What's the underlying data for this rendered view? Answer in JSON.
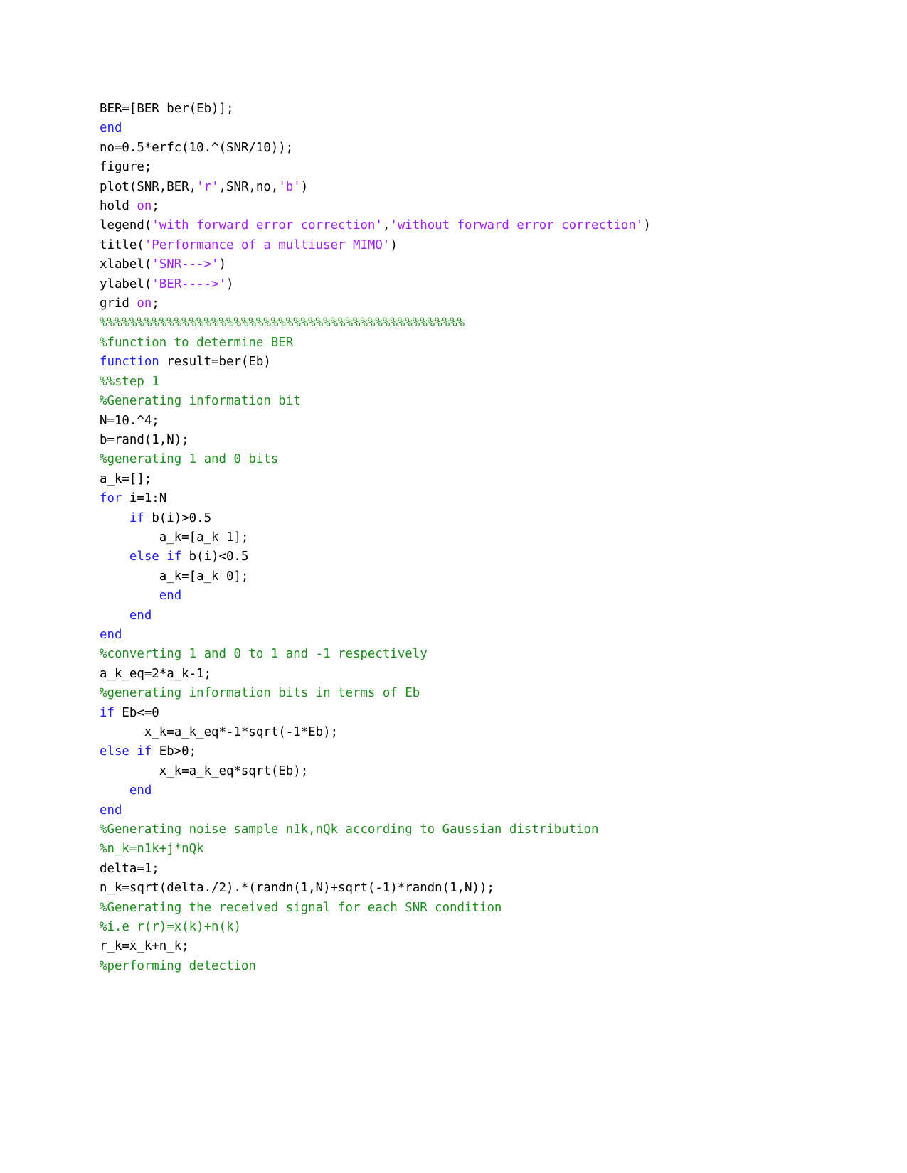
{
  "document": {
    "type": "matlab-source-listing",
    "page_background": "#ffffff",
    "colors": {
      "keyword": "#2222e8",
      "string": "#a020f0",
      "comment": "#228b22",
      "plain": "#000000"
    },
    "lines": [
      {
        "id": "line-1",
        "tokens": [
          {
            "t": "BER=[BER ber(Eb)];",
            "c": "plain"
          }
        ]
      },
      {
        "id": "line-2",
        "tokens": [
          {
            "t": "end",
            "c": "key"
          }
        ]
      },
      {
        "id": "line-3",
        "tokens": [
          {
            "t": "no=0.5*erfc(10.^(SNR/10));",
            "c": "plain"
          }
        ]
      },
      {
        "id": "line-4",
        "tokens": [
          {
            "t": "figure;",
            "c": "plain"
          }
        ]
      },
      {
        "id": "line-5",
        "tokens": [
          {
            "t": "plot(SNR,BER,",
            "c": "plain"
          },
          {
            "t": "'r'",
            "c": "str"
          },
          {
            "t": ",SNR,no,",
            "c": "plain"
          },
          {
            "t": "'b'",
            "c": "str"
          },
          {
            "t": ")",
            "c": "plain"
          }
        ]
      },
      {
        "id": "line-6",
        "tokens": [
          {
            "t": "hold ",
            "c": "plain"
          },
          {
            "t": "on",
            "c": "str"
          },
          {
            "t": ";",
            "c": "plain"
          }
        ]
      },
      {
        "id": "line-7",
        "tokens": [
          {
            "t": "legend(",
            "c": "plain"
          },
          {
            "t": "'with forward error correction'",
            "c": "str"
          },
          {
            "t": ",",
            "c": "plain"
          },
          {
            "t": "'without forward error correction'",
            "c": "str"
          },
          {
            "t": ")",
            "c": "plain"
          }
        ]
      },
      {
        "id": "line-8",
        "tokens": [
          {
            "t": "title(",
            "c": "plain"
          },
          {
            "t": "'Performance of a multiuser MIMO'",
            "c": "str"
          },
          {
            "t": ")",
            "c": "plain"
          }
        ]
      },
      {
        "id": "line-9",
        "tokens": [
          {
            "t": "xlabel(",
            "c": "plain"
          },
          {
            "t": "'SNR--->'",
            "c": "str"
          },
          {
            "t": ")",
            "c": "plain"
          }
        ]
      },
      {
        "id": "line-10",
        "tokens": [
          {
            "t": "ylabel(",
            "c": "plain"
          },
          {
            "t": "'BER---->'",
            "c": "str"
          },
          {
            "t": ")",
            "c": "plain"
          }
        ]
      },
      {
        "id": "line-11",
        "tokens": [
          {
            "t": "grid ",
            "c": "plain"
          },
          {
            "t": "on",
            "c": "str"
          },
          {
            "t": ";",
            "c": "plain"
          }
        ]
      },
      {
        "id": "line-12",
        "tokens": [
          {
            "t": "%%%%%%%%%%%%%%%%%%%%%%%%%%%%%%%%%%%%%%%%%%%%%%%%%",
            "c": "com"
          }
        ]
      },
      {
        "id": "line-13",
        "tokens": [
          {
            "t": "%function to determine BER",
            "c": "com"
          }
        ]
      },
      {
        "id": "line-14",
        "tokens": [
          {
            "t": "function",
            "c": "key"
          },
          {
            "t": " result=ber(Eb)",
            "c": "plain"
          }
        ]
      },
      {
        "id": "line-15",
        "tokens": [
          {
            "t": "%%step 1",
            "c": "com"
          }
        ]
      },
      {
        "id": "line-16",
        "tokens": [
          {
            "t": "%Generating information bit",
            "c": "com"
          }
        ]
      },
      {
        "id": "line-17",
        "tokens": [
          {
            "t": "N=10.^4;",
            "c": "plain"
          }
        ]
      },
      {
        "id": "line-18",
        "tokens": [
          {
            "t": "b=rand(1,N);",
            "c": "plain"
          }
        ]
      },
      {
        "id": "line-19",
        "tokens": [
          {
            "t": "%generating 1 and 0 bits",
            "c": "com"
          }
        ]
      },
      {
        "id": "line-20",
        "tokens": [
          {
            "t": "a_k=[];",
            "c": "plain"
          }
        ]
      },
      {
        "id": "line-21",
        "tokens": [
          {
            "t": "for",
            "c": "key"
          },
          {
            "t": " i=1:N",
            "c": "plain"
          }
        ]
      },
      {
        "id": "line-22",
        "tokens": [
          {
            "t": "    ",
            "c": "plain"
          },
          {
            "t": "if",
            "c": "key"
          },
          {
            "t": " b(i)>0.5",
            "c": "plain"
          }
        ]
      },
      {
        "id": "line-23",
        "tokens": [
          {
            "t": "        a_k=[a_k 1];",
            "c": "plain"
          }
        ]
      },
      {
        "id": "line-24",
        "tokens": [
          {
            "t": "    ",
            "c": "plain"
          },
          {
            "t": "else if",
            "c": "key"
          },
          {
            "t": " b(i)<0.5",
            "c": "plain"
          }
        ]
      },
      {
        "id": "line-25",
        "tokens": [
          {
            "t": "        a_k=[a_k 0];",
            "c": "plain"
          }
        ]
      },
      {
        "id": "line-26",
        "tokens": [
          {
            "t": "        ",
            "c": "plain"
          },
          {
            "t": "end",
            "c": "key"
          }
        ]
      },
      {
        "id": "line-27",
        "tokens": [
          {
            "t": "    ",
            "c": "plain"
          },
          {
            "t": "end",
            "c": "key"
          }
        ]
      },
      {
        "id": "line-28",
        "tokens": [
          {
            "t": "end",
            "c": "key"
          }
        ]
      },
      {
        "id": "line-29",
        "tokens": [
          {
            "t": "%converting 1 and 0 to 1 and -1 respectively",
            "c": "com"
          }
        ]
      },
      {
        "id": "line-30",
        "tokens": [
          {
            "t": "a_k_eq=2*a_k-1;",
            "c": "plain"
          }
        ]
      },
      {
        "id": "line-31",
        "tokens": [
          {
            "t": "%generating information bits in terms of Eb",
            "c": "com"
          }
        ]
      },
      {
        "id": "line-32",
        "tokens": [
          {
            "t": "if",
            "c": "key"
          },
          {
            "t": " Eb<=0",
            "c": "plain"
          }
        ]
      },
      {
        "id": "line-33",
        "tokens": [
          {
            "t": "      x_k=a_k_eq*-1*sqrt(-1*Eb);",
            "c": "plain"
          }
        ]
      },
      {
        "id": "line-34",
        "tokens": [
          {
            "t": "else if",
            "c": "key"
          },
          {
            "t": " Eb>0;",
            "c": "plain"
          }
        ]
      },
      {
        "id": "line-35",
        "tokens": [
          {
            "t": "        x_k=a_k_eq*sqrt(Eb);",
            "c": "plain"
          }
        ]
      },
      {
        "id": "line-36",
        "tokens": [
          {
            "t": "    ",
            "c": "plain"
          },
          {
            "t": "end",
            "c": "key"
          }
        ]
      },
      {
        "id": "line-37",
        "tokens": [
          {
            "t": "end",
            "c": "key"
          }
        ]
      },
      {
        "id": "line-38",
        "tokens": [
          {
            "t": "%Generating noise sample n1k,nQk according to Gaussian distribution",
            "c": "com"
          }
        ]
      },
      {
        "id": "line-39",
        "tokens": [
          {
            "t": "%n_k=n1k+j*nQk",
            "c": "com"
          }
        ]
      },
      {
        "id": "line-40",
        "tokens": [
          {
            "t": "delta=1;",
            "c": "plain"
          }
        ]
      },
      {
        "id": "line-41",
        "tokens": [
          {
            "t": "n_k=sqrt(delta./2).*(randn(1,N)+sqrt(-1)*randn(1,N));",
            "c": "plain"
          }
        ]
      },
      {
        "id": "line-42",
        "tokens": [
          {
            "t": "%Generating the received signal for each SNR condition",
            "c": "com"
          }
        ]
      },
      {
        "id": "line-43",
        "tokens": [
          {
            "t": "%i.e r(r)=x(k)+n(k)",
            "c": "com"
          }
        ]
      },
      {
        "id": "line-44",
        "tokens": [
          {
            "t": "r_k=x_k+n_k;",
            "c": "plain"
          }
        ]
      },
      {
        "id": "line-45",
        "tokens": [
          {
            "t": "%performing detection",
            "c": "com"
          }
        ]
      }
    ]
  }
}
